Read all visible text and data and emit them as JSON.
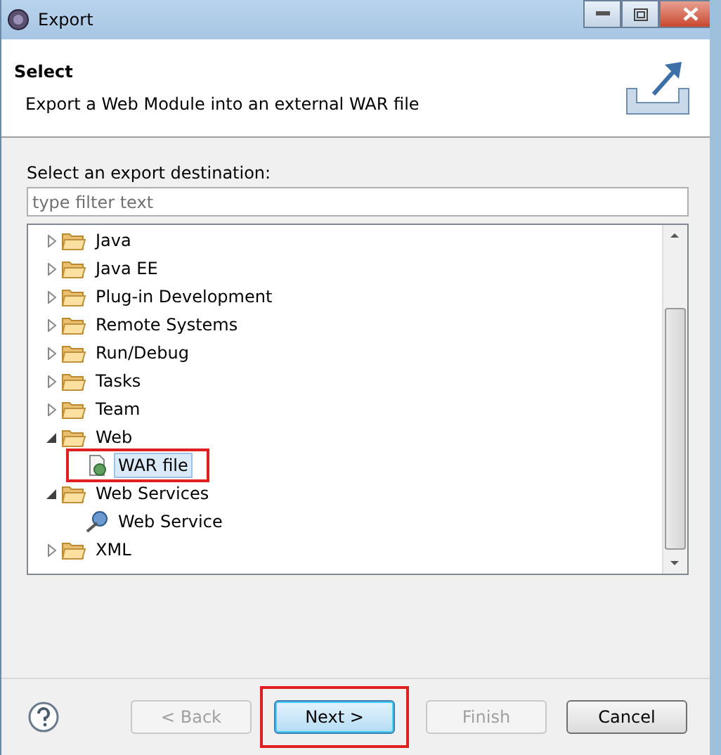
{
  "window": {
    "title": "Export"
  },
  "header": {
    "title": "Select",
    "description": "Export a Web Module into an external WAR file"
  },
  "destination_label": "Select an export destination:",
  "filter": {
    "placeholder": "type filter text"
  },
  "tree": [
    {
      "label": "Java",
      "kind": "folder",
      "expanded": false,
      "selected": false
    },
    {
      "label": "Java EE",
      "kind": "folder",
      "expanded": false,
      "selected": false
    },
    {
      "label": "Plug-in Development",
      "kind": "folder",
      "expanded": false,
      "selected": false
    },
    {
      "label": "Remote Systems",
      "kind": "folder",
      "expanded": false,
      "selected": false
    },
    {
      "label": "Run/Debug",
      "kind": "folder",
      "expanded": false,
      "selected": false
    },
    {
      "label": "Tasks",
      "kind": "folder",
      "expanded": false,
      "selected": false
    },
    {
      "label": "Team",
      "kind": "folder",
      "expanded": false,
      "selected": false
    },
    {
      "label": "Web",
      "kind": "folder",
      "expanded": true,
      "selected": false,
      "children": [
        {
          "label": "WAR file",
          "kind": "war",
          "selected": true,
          "highlighted": true
        }
      ]
    },
    {
      "label": "Web Services",
      "kind": "folder",
      "expanded": true,
      "selected": false,
      "children": [
        {
          "label": "Web Service",
          "kind": "service",
          "selected": false,
          "highlighted": false
        }
      ]
    },
    {
      "label": "XML",
      "kind": "folder",
      "expanded": false,
      "selected": false
    }
  ],
  "buttons": [
    {
      "label": "< Back",
      "disabled": true,
      "default": false,
      "highlighted": false
    },
    {
      "label": "Next >",
      "disabled": false,
      "default": true,
      "highlighted": true
    },
    {
      "label": "Finish",
      "disabled": true,
      "default": false,
      "highlighted": false
    },
    {
      "label": "Cancel",
      "disabled": false,
      "default": false,
      "highlighted": false
    }
  ]
}
